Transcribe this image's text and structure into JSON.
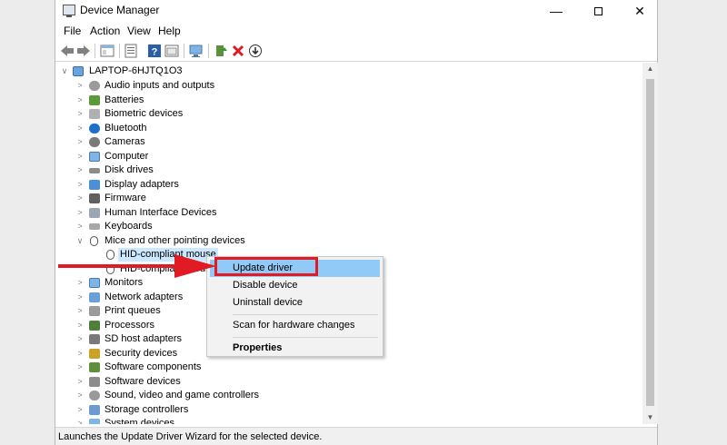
{
  "window": {
    "title": "Device Manager",
    "controls": {
      "minimize": "—",
      "close": "✕"
    }
  },
  "menu": [
    "File",
    "Action",
    "View",
    "Help"
  ],
  "tree": {
    "root": "LAPTOP-6HJTQ1O3",
    "items": [
      "Audio inputs and outputs",
      "Batteries",
      "Biometric devices",
      "Bluetooth",
      "Cameras",
      "Computer",
      "Disk drives",
      "Display adapters",
      "Firmware",
      "Human Interface Devices",
      "Keyboards",
      "Mice and other pointing devices",
      "HID-compliant mouse",
      "HID-compliant mouse",
      "Monitors",
      "Network adapters",
      "Print queues",
      "Processors",
      "SD host adapters",
      "Security devices",
      "Software components",
      "Software devices",
      "Sound, video and game controllers",
      "Storage controllers",
      "System devices"
    ]
  },
  "context_menu": {
    "items": [
      "Update driver",
      "Disable device",
      "Uninstall device",
      "Scan for hardware changes",
      "Properties"
    ]
  },
  "status": "Launches the Update Driver Wizard for the selected device.",
  "colors": {
    "highlight": "#91c9f7",
    "annotation_red": "#e01b24"
  }
}
